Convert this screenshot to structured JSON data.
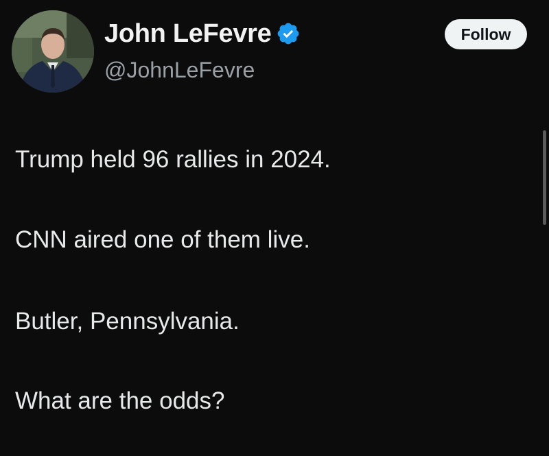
{
  "author": {
    "display_name": "John LeFevre",
    "handle": "@JohnLeFevre",
    "verified": true,
    "avatar_icon": "profile-photo"
  },
  "follow_button": {
    "label": "Follow"
  },
  "tweet": {
    "lines": [
      "Trump held 96 rallies in 2024.",
      "CNN aired one of them live.",
      "Butler, Pennsylvania.",
      "What are the odds?"
    ]
  },
  "colors": {
    "background": "#0c0c0c",
    "text": "#e7e9ea",
    "handle": "#9aa0a6",
    "verified_badge": "#1d9bf0",
    "follow_button_bg": "#eff3f4"
  }
}
